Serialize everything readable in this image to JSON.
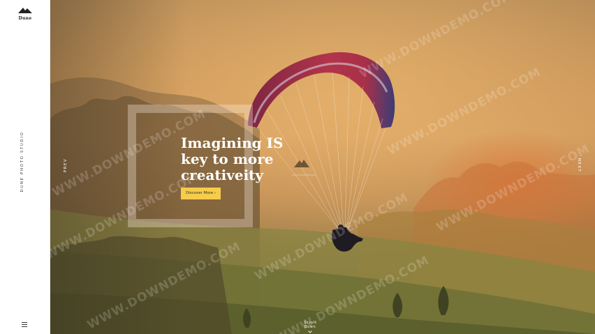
{
  "sidebar": {
    "logo_text": "Dune",
    "studio_label": "DUNE PHOTO STUDIO",
    "menu_icon": "hamburger-menu-icon"
  },
  "hero": {
    "headline_lines": [
      "Imagining IS",
      "key to more",
      "creativeity"
    ],
    "cta_label": "Discover More ›",
    "prev_label": "PREV",
    "next_label": "NEXT",
    "scroll_label": "Scroll Down",
    "scroll_icon": "chevron-down-icon"
  },
  "watermark": {
    "text": "WWW.DOWNDEMO.COM"
  },
  "colors": {
    "accent_button": "#f6cd4b",
    "sidebar_bg": "#ffffff",
    "text_light": "#ffffff"
  }
}
